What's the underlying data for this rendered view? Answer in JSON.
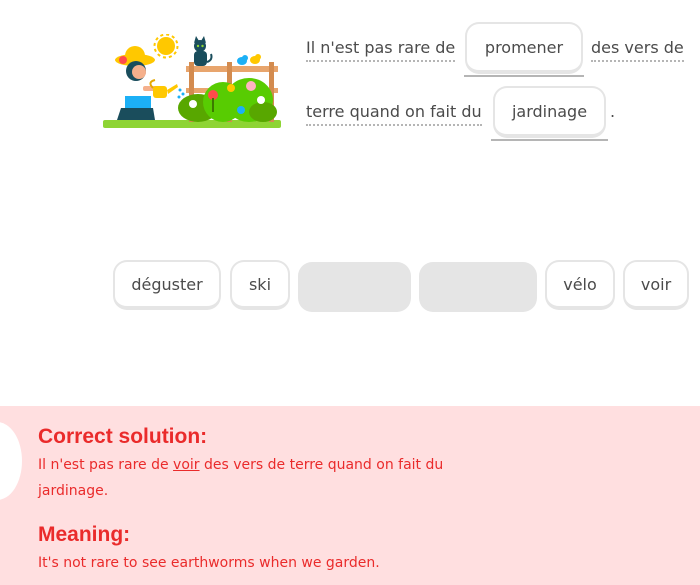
{
  "exercise": {
    "sentence": {
      "part1": "Il n'est pas rare de",
      "blank1": "promener",
      "part2": "des vers de",
      "part3": "terre quand on fait du",
      "blank2": "jardinage",
      "period": "."
    },
    "word_bank": [
      {
        "label": "déguster",
        "state": "available"
      },
      {
        "label": "ski",
        "state": "available"
      },
      {
        "label": "",
        "state": "used"
      },
      {
        "label": "",
        "state": "used"
      },
      {
        "label": "vélo",
        "state": "available"
      },
      {
        "label": "voir",
        "state": "available"
      }
    ]
  },
  "feedback": {
    "status": "incorrect",
    "correct_heading": "Correct solution:",
    "solution_before": "Il n'est pas rare de ",
    "solution_highlight": "voir",
    "solution_after": " des vers de terre quand on fait du jardinage.",
    "meaning_heading": "Meaning:",
    "meaning_text": "It's not rare to see earthworms when we garden.",
    "colors": {
      "panel_bg": "#ffdfe0",
      "text": "#ea2b2b"
    }
  },
  "illustration": {
    "icon": "gardening-scene-icon",
    "elements": [
      "sun-icon",
      "cat-icon",
      "bird-icon",
      "girl-watering-can-icon",
      "bush-flowers-icon",
      "fence-icon"
    ]
  }
}
